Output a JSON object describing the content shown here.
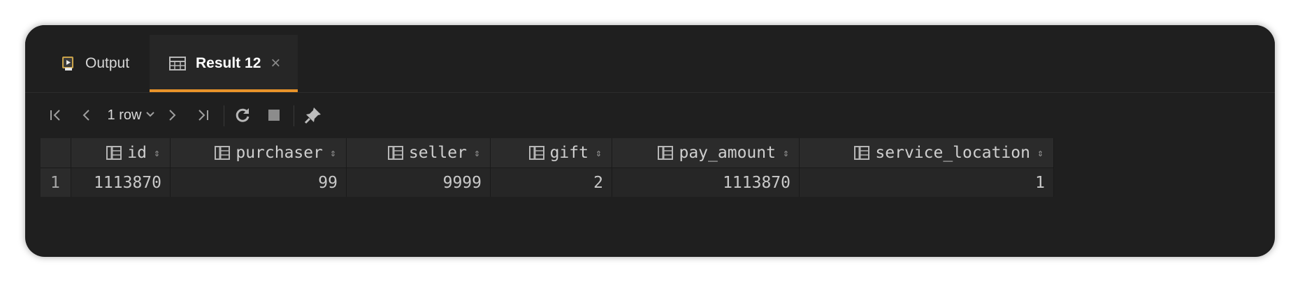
{
  "tabs": [
    {
      "label": "Output",
      "icon": "output-icon"
    },
    {
      "label": "Result 12",
      "icon": "table-icon",
      "active": true
    }
  ],
  "toolbar": {
    "row_count": "1 row",
    "icons": [
      "first-page-icon",
      "prev-page-icon",
      "chevron-down-icon",
      "next-page-icon",
      "last-page-icon",
      "refresh-icon",
      "stop-icon",
      "pin-icon"
    ]
  },
  "grid": {
    "columns": [
      "id",
      "purchaser",
      "seller",
      "gift",
      "pay_amount",
      "service_location"
    ],
    "rows": [
      {
        "num": "1",
        "cells": [
          "1113870",
          "99",
          "9999",
          "2",
          "1113870",
          "1"
        ]
      }
    ]
  },
  "colors": {
    "accent": "#e8932a",
    "background": "#1f1f1f"
  }
}
